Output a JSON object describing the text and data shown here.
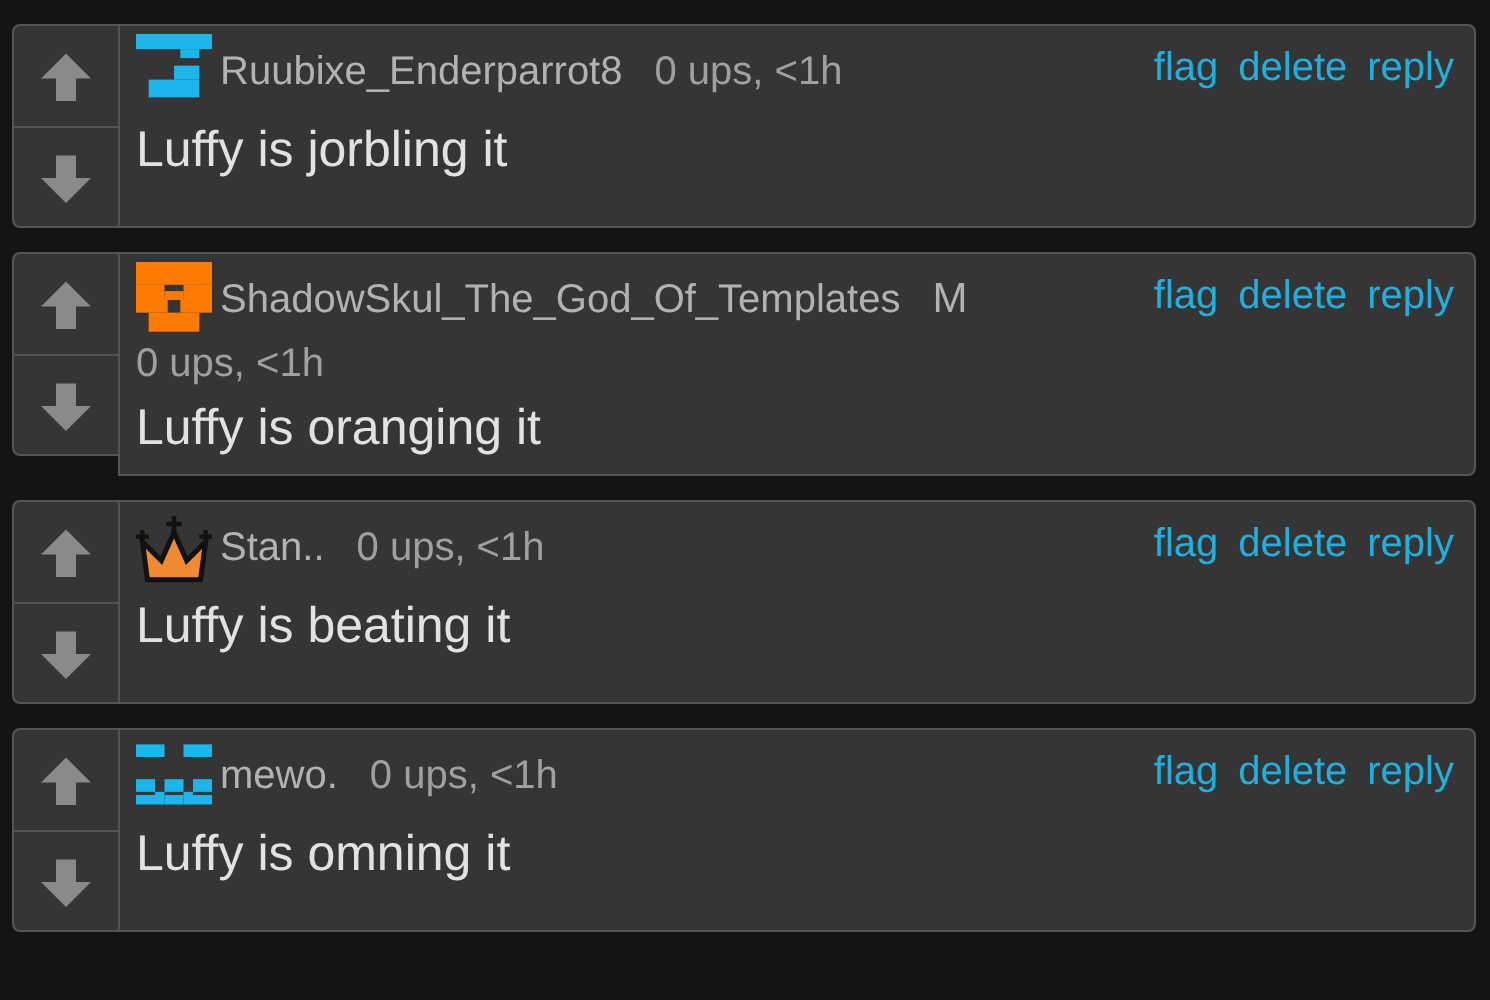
{
  "comments": [
    {
      "avatar": {
        "kind": "glyph",
        "color": "#1cb6ec"
      },
      "username": "Ruubixe_Enderparrot8",
      "stats": "0 ups, <1h",
      "actions": [
        "flag",
        "delete",
        "reply"
      ],
      "text": "Luffy is jorbling it"
    },
    {
      "avatar": {
        "kind": "skull",
        "color": "#ff7b00"
      },
      "username": "ShadowSkul_The_God_Of_Templates",
      "badge": "M",
      "stats": "0 ups, <1h",
      "actions": [
        "flag",
        "delete",
        "reply"
      ],
      "text": "Luffy is oranging it"
    },
    {
      "avatar": {
        "kind": "crown",
        "color": "#f08a30"
      },
      "username": "Stan..",
      "stats": "0 ups, <1h",
      "actions": [
        "flag",
        "delete",
        "reply"
      ],
      "text": "Luffy is beating it"
    },
    {
      "avatar": {
        "kind": "face",
        "color": "#1cb6ec"
      },
      "username": "mewo.",
      "stats": "0 ups, <1h",
      "actions": [
        "flag",
        "delete",
        "reply"
      ],
      "text": "Luffy is omning it"
    }
  ]
}
